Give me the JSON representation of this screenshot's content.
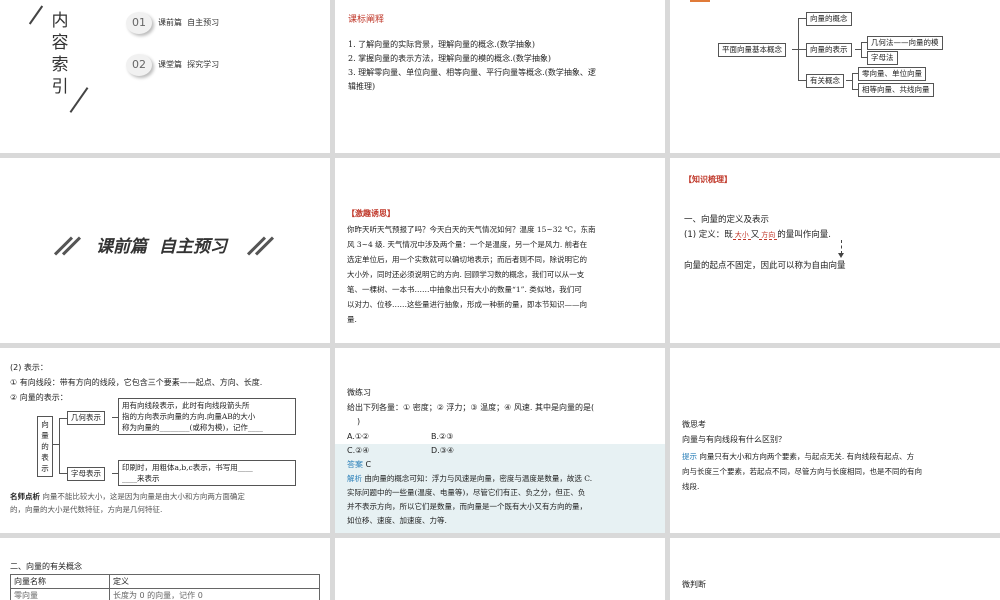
{
  "t1": {
    "title_chars": [
      "内",
      "容",
      "索",
      "引"
    ],
    "items": [
      {
        "num": "01",
        "label": "课前篇  自主预习"
      },
      {
        "num": "02",
        "label": "课堂篇  探究学习"
      }
    ]
  },
  "t2": {
    "heading": "课标阐释",
    "lines": [
      "1. 了解向量的实际背景，理解向量的概念.(数学抽象)",
      "2. 掌握向量的表示方法，理解向量的模的概念.(数学抽象)",
      "3. 理解零向量、单位向量、相等向量、平行向量等概念.(数学抽象、逻",
      "辑推理)"
    ]
  },
  "t3": {
    "root": "平面向量基本概念",
    "b1": "向量的概念",
    "b2": "向量的表示",
    "b2a": "几何法——向量的模",
    "b2b": "字母法",
    "b3": "有关概念",
    "b3a": "零向量、单位向量",
    "b3b": "相等向量、共线向量"
  },
  "t4": {
    "title": "课前篇  自主预习"
  },
  "t5": {
    "heading": "【激趣诱思】",
    "lines": [
      "你昨天听天气预报了吗？今天白天的天气情况如何？温度 15~32 ℃，东南",
      "风 3~4 级. 天气情况中涉及两个量：一个是温度，另一个是风力. 前者在",
      "选定单位后，用一个实数就可以确切地表示；而后者则不同，除说明它的",
      "大小外，同时还必须说明它的方向. 回顾学习数的概念，我们可以从一支",
      "笔、一棵树、一本书……中抽象出只有大小的数量“1”. 类似地，我们可",
      "以对力、位移……这些量进行抽象，形成一种新的量，即本节知识——向",
      "量."
    ]
  },
  "t6": {
    "heading": "【知识梳理】",
    "section": "一、向量的定义及表示",
    "def_prefix": "(1) 定义：既",
    "def_blank1": "大小",
    "def_mid": "又",
    "def_blank2": "方向",
    "def_suffix": "的量叫作向量.",
    "note": "向量的起点不固定，因此可以称为自由向量"
  },
  "t7": {
    "l1": "(2) 表示：",
    "l2": "① 有向线段：带有方向的线段，它包含三个要素——起点、方向、长度.",
    "l3": "② 向量的表示：",
    "vbox": [
      "向",
      "量",
      "的",
      "表",
      "示"
    ],
    "geo": "几何表示",
    "geo_text1": "用有向线段表示，此时有向线段箭头所",
    "geo_text2": "指的方向表示向量的方向.向量AB的大小",
    "geo_text3": "称为向量的________(或称为模)，记作____",
    "let": "字母表示",
    "let_text1": "印刷时，用粗体a,b,c表示，书写用____",
    "let_text2": "____来表示",
    "tip_label": "名师点析",
    "tip1": "向量不能比较大小，这是因为向量是由大小和方向两方面确定",
    "tip2": "的，向量的大小是代数特征，方向是几何特征."
  },
  "t8": {
    "title": "微练习",
    "q": "给出下列各量：① 密度；② 浮力；③ 温度；④ 风速. 其中是向量的是(",
    "q_end": ")",
    "opts": [
      "A.①②",
      "B.②③",
      "C.②④",
      "D.③④"
    ],
    "ans_label": "答案",
    "ans": "C",
    "exp_label": "解析",
    "exp": [
      "由向量的概念可知：浮力与风速是向量，密度与温度是数量，故选 C.",
      "实际问题中的一些量(温度、电量等)，尽管它们有正、负之分，但正、负",
      "并不表示方向，所以它们是数量，而向量是一个既有大小又有方向的量，",
      "如位移、速度、加速度、力等."
    ]
  },
  "t9": {
    "title": "微思考",
    "q": "向量与有向线段有什么区别？",
    "tip_label": "提示",
    "tip": [
      "向量只有大小和方向两个要素，与起点无关. 有向线段有起点、方",
      "向与长度三个要素，若起点不同，尽管方向与长度相同，也是不同的有向",
      "线段."
    ]
  },
  "t10": {
    "section": "二、向量的有关概念",
    "col1": "向量名称",
    "col2": "定义",
    "row1a": "零向量",
    "row1b": "长度为 0 的向量，记作 0"
  },
  "t12": {
    "title": "微判断"
  }
}
